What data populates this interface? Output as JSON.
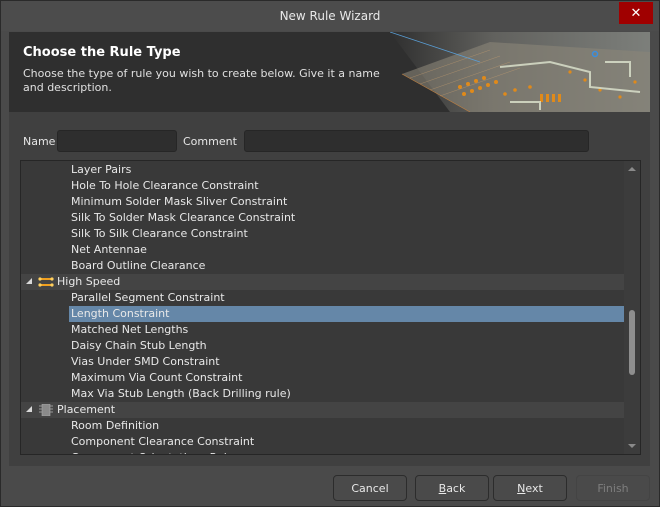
{
  "window": {
    "title": "New Rule Wizard",
    "close_icon": "close-icon"
  },
  "header": {
    "title": "Choose the Rule Type",
    "description": "Choose the type of rule you wish to create below. Give it a name and description.",
    "banner_image": "pcb-board-illustration"
  },
  "fields": {
    "name_label": "Name",
    "name_value": "",
    "comment_label": "Comment",
    "comment_value": ""
  },
  "tree": {
    "rows": [
      {
        "type": "item",
        "label": "Layer Pairs"
      },
      {
        "type": "item",
        "label": "Hole To Hole Clearance Constraint"
      },
      {
        "type": "item",
        "label": "Minimum Solder Mask Sliver Constraint"
      },
      {
        "type": "item",
        "label": "Silk To Solder Mask Clearance Constraint"
      },
      {
        "type": "item",
        "label": "Silk To Silk Clearance Constraint"
      },
      {
        "type": "item",
        "label": "Net Antennae"
      },
      {
        "type": "item",
        "label": "Board Outline Clearance"
      },
      {
        "type": "group",
        "label": "High Speed",
        "icon": "high-speed-icon",
        "expanded": true
      },
      {
        "type": "item",
        "label": "Parallel Segment Constraint"
      },
      {
        "type": "item",
        "label": "Length Constraint",
        "selected": true
      },
      {
        "type": "item",
        "label": "Matched Net Lengths"
      },
      {
        "type": "item",
        "label": "Daisy Chain Stub Length"
      },
      {
        "type": "item",
        "label": "Vias Under SMD Constraint"
      },
      {
        "type": "item",
        "label": "Maximum Via Count Constraint"
      },
      {
        "type": "item",
        "label": "Max Via Stub Length (Back Drilling rule)"
      },
      {
        "type": "group",
        "label": "Placement",
        "icon": "placement-chip-icon",
        "expanded": true
      },
      {
        "type": "item",
        "label": "Room Definition"
      },
      {
        "type": "item",
        "label": "Component Clearance Constraint"
      },
      {
        "type": "item",
        "label": "Component Orientations Rule"
      }
    ],
    "scroll_position": 0.55
  },
  "buttons": {
    "cancel": "Cancel",
    "back_mnemonic": "B",
    "back_rest": "ack",
    "next_mnemonic": "N",
    "next_rest": "ext",
    "finish": "Finish"
  },
  "colors": {
    "selection": "#6587a8",
    "close_button": "#a00000",
    "high_speed_icon": "#f0a020"
  }
}
